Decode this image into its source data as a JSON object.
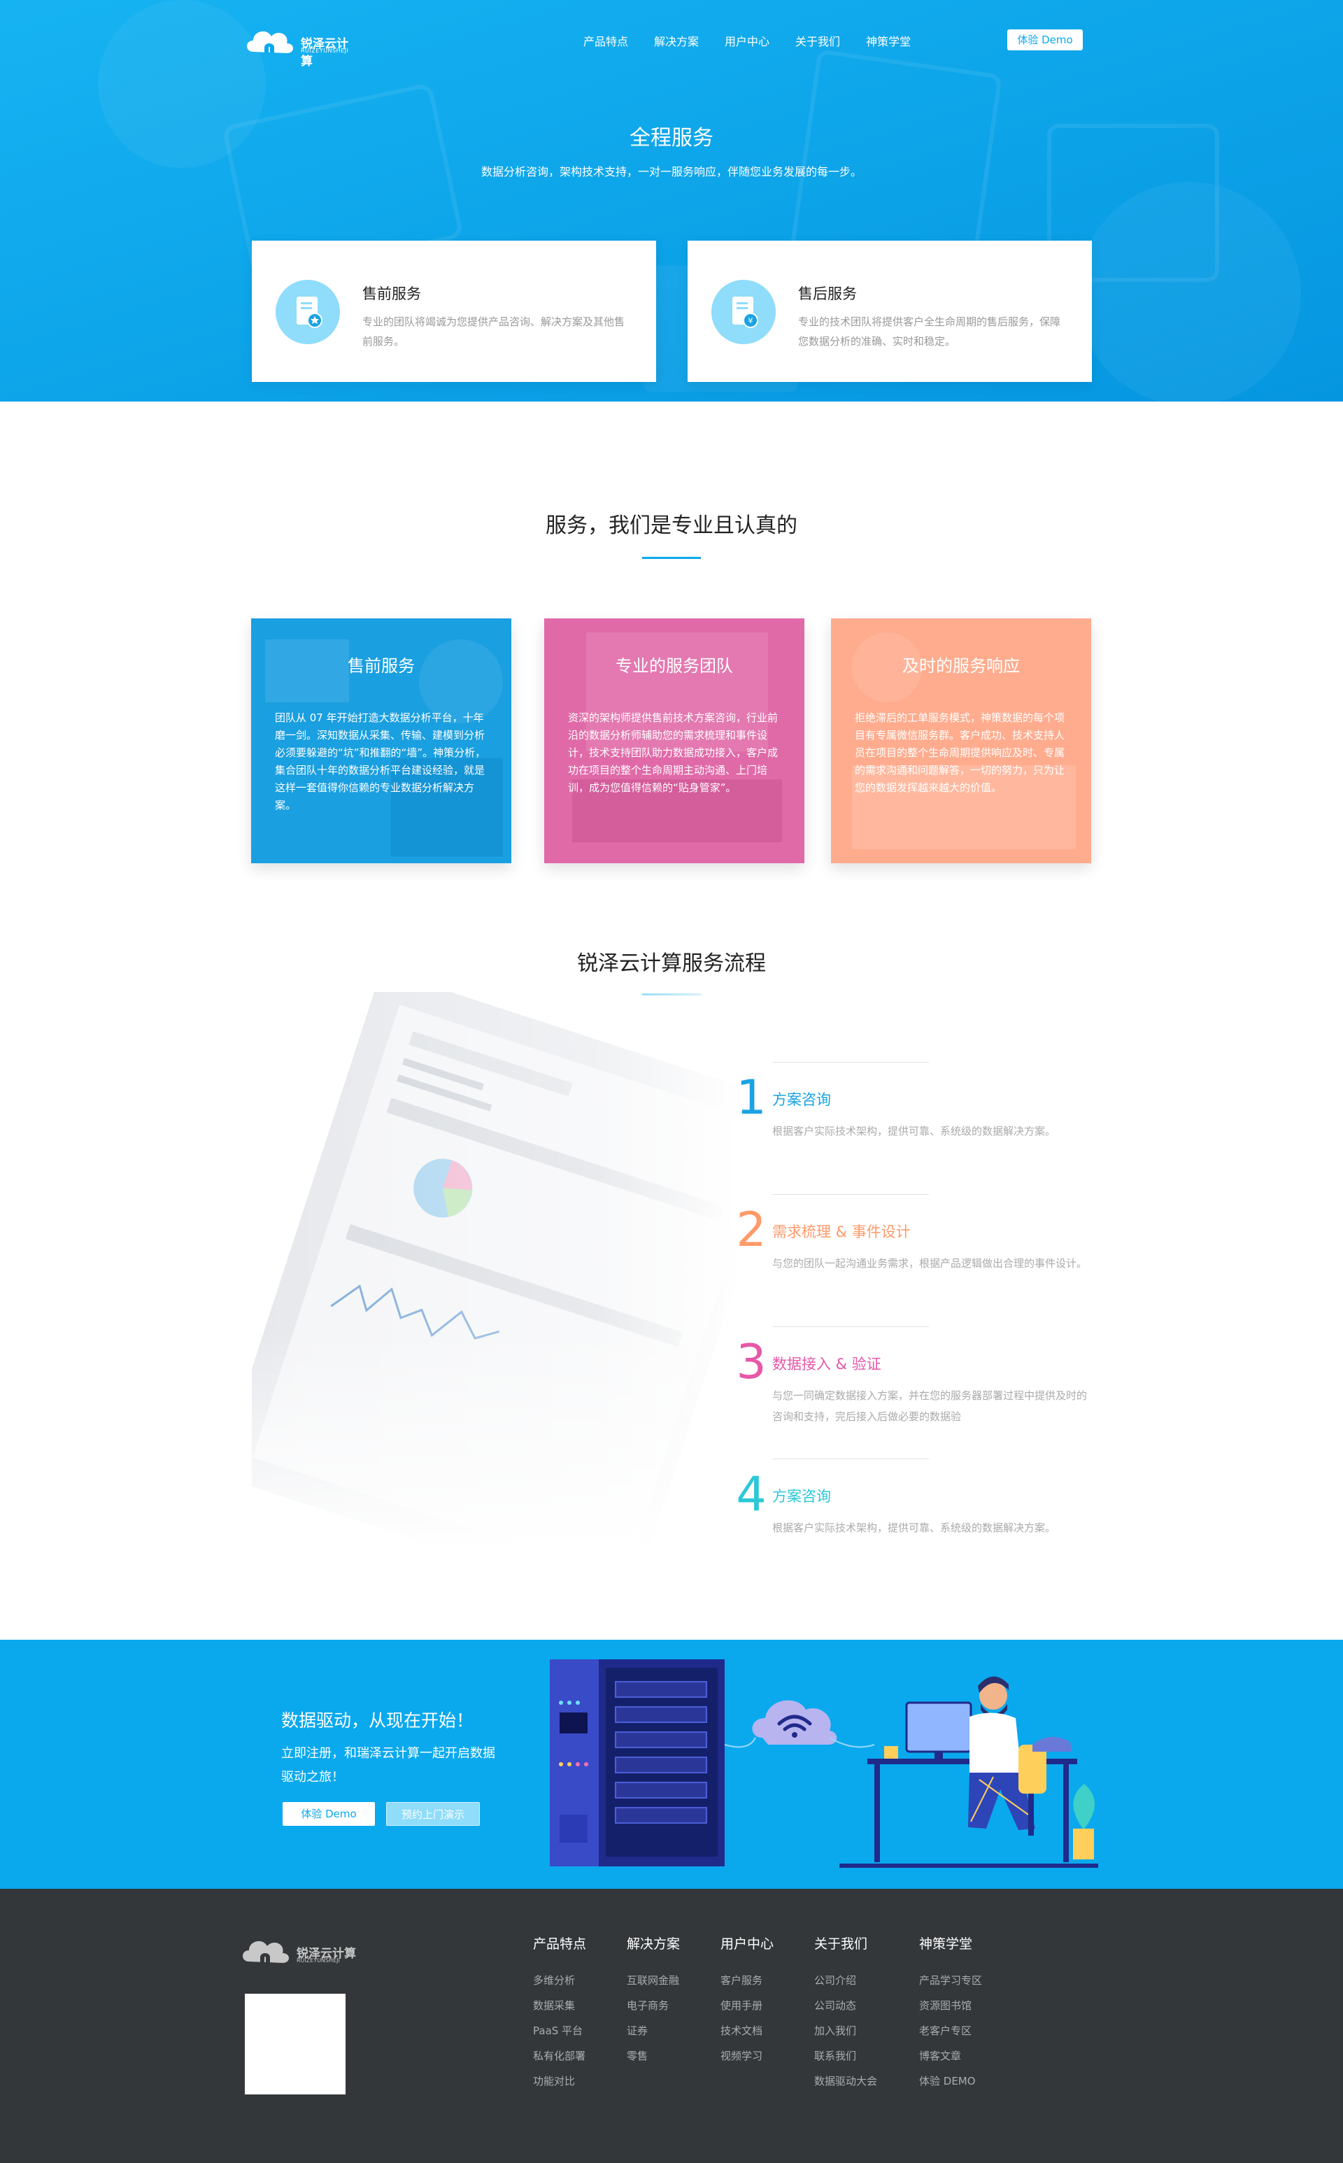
{
  "brand": {
    "logo_text": "锐泽云计算",
    "logo_sub": "RUIZEYUNSHEJI"
  },
  "nav": {
    "items": [
      "产品特点",
      "解决方案",
      "用户中心",
      "关于我们",
      "神策学堂"
    ],
    "demo_label": "体验 Demo"
  },
  "hero": {
    "title": "全程服务",
    "subtitle": "数据分析咨询，架构技术支持，一对一服务响应，伴随您业务发展的每一步。",
    "cards": [
      {
        "title": "售前服务",
        "desc": "专业的团队将竭诚为您提供产品咨询、解决方案及其他售前服务。",
        "icon": "document-star-icon"
      },
      {
        "title": "售后服务",
        "desc": "专业的技术团队将提供客户全生命周期的售后服务，保障您数据分析的准确、实时和稳定。",
        "icon": "document-dollar-icon"
      }
    ]
  },
  "features": {
    "title": "服务，我们是专业且认真的",
    "cards": [
      {
        "title": "售前服务",
        "desc": "团队从 07 年开始打造大数据分析平台，十年磨一剑。深知数据从采集、传输、建模到分析必须要躲避的“坑”和推翻的“墙”。神策分析，集合团队十年的数据分析平台建设经验，就是这样一套值得你信赖的专业数据分析解决方案。",
        "color": "#1a9fe0"
      },
      {
        "title": "专业的服务团队",
        "desc": "资深的架构师提供售前技术方案咨询，行业前沿的数据分析师辅助您的需求梳理和事件设计，技术支持团队助力数据成功接入，客户成功在项目的整个生命周期主动沟通、上门培训，成为您值得信赖的“贴身管家”。",
        "color": "#e06aa8"
      },
      {
        "title": "及时的服务响应",
        "desc": "拒绝滞后的工单服务模式，神策数据的每个项目有专属微信服务群。客户成功、技术支持人员在项目的整个生命周期提供响应及时、专属的需求沟通和问题解答，一切的努力，只为让您的数据发挥越来越大的价值。",
        "color": "#ffac8e"
      }
    ]
  },
  "process": {
    "title": "锐泽云计算服务流程",
    "steps": [
      {
        "num": "1",
        "title": "方案咨询",
        "desc": "根据客户实际技术架构，提供可靠、系统级的数据解决方案。",
        "color": "#1aa3e2"
      },
      {
        "num": "2",
        "title": "需求梳理 & 事件设计",
        "desc": "与您的团队一起沟通业务需求，根据产品逻辑做出合理的事件设计。",
        "color": "#ff9a6a"
      },
      {
        "num": "3",
        "title": "数据接入 & 验证",
        "desc": "与您一同确定数据接入方案，并在您的服务器部署过程中提供及时的咨询和支持，完后接入后做必要的数据验",
        "color": "#e658a8"
      },
      {
        "num": "4",
        "title": "方案咨询",
        "desc": "根据客户实际技术架构，提供可靠、系统级的数据解决方案。",
        "color": "#2cc8d8"
      }
    ]
  },
  "cta": {
    "title": "数据驱动，从现在开始！",
    "subtitle": "立即注册，和瑞泽云计算一起开启数据驱动之旅！",
    "btn1": "体验 Demo",
    "btn2": "预约上门演示"
  },
  "footer": {
    "logo_text": "锐泽云计算",
    "logo_sub": "RUIZEYUNSHEJI",
    "columns": [
      {
        "head": "产品特点",
        "items": [
          "多维分析",
          "数据采集",
          "PaaS 平台",
          "私有化部署",
          "功能对比"
        ]
      },
      {
        "head": "解决方案",
        "items": [
          "互联网金融",
          "电子商务",
          "证券",
          "零售"
        ]
      },
      {
        "head": "用户中心",
        "items": [
          "客户服务",
          "使用手册",
          "技术文档",
          "视频学习"
        ]
      },
      {
        "head": "关于我们",
        "items": [
          "公司介绍",
          "公司动态",
          "加入我们",
          "联系我们",
          "数据驱动大会"
        ]
      },
      {
        "head": "神策学堂",
        "items": [
          "产品学习专区",
          "资源图书馆",
          "老客户专区",
          "博客文章",
          "体验 DEMO"
        ]
      }
    ]
  }
}
